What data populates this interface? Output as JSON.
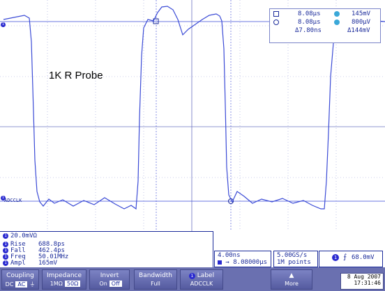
{
  "screen": {
    "probe_label": "1K R Probe",
    "ch1_label": "ADCCLK",
    "trace_color": "#3a4ad6",
    "grid_color": "#9aa0d8"
  },
  "cursor_readout": {
    "row1_time": "8.08μs",
    "row1_volt": "145mV",
    "row2_time": "8.08μs",
    "row2_volt": "800μV",
    "delta_time": "Δ7.80ns",
    "delta_volt": "Δ144mV"
  },
  "measurements": {
    "scale": "20.0mVΩ",
    "items": [
      {
        "name": "Rise",
        "value": "688.8ps"
      },
      {
        "name": "Fall",
        "value": "462.4ps"
      },
      {
        "name": "Freq",
        "value": "50.01MHz"
      },
      {
        "name": "Ampl",
        "value": "165mV"
      }
    ]
  },
  "timebase": {
    "per_div": "4.00ns",
    "position": "8.08000μs"
  },
  "sampling": {
    "rate": "5.00GS/s",
    "points": "1M points"
  },
  "trigger": {
    "level": "68.0mV"
  },
  "menu": {
    "coupling_label": "Coupling",
    "coupling_options": [
      "DC",
      "AC"
    ],
    "impedance_label": "Impedance",
    "impedance_options": [
      "1MΩ",
      "50Ω"
    ],
    "invert_label": "Invert",
    "invert_options": [
      "On",
      "Off"
    ],
    "bandwidth_label": "Bandwidth",
    "bandwidth_value": "Full",
    "label_label": "Label",
    "label_value": "ADCCLK",
    "more_label": "More"
  },
  "datetime": {
    "date": "8 Aug 2007",
    "time": "17:31:46"
  }
}
